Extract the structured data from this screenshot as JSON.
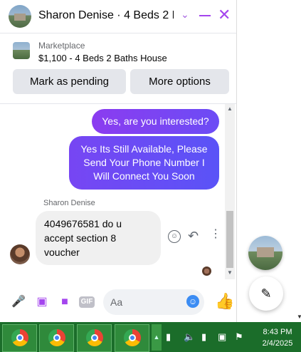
{
  "header": {
    "title": "Sharon Denise · 4 Beds 2 B...",
    "avatar_icon": "house-photo",
    "chevron_icon": "chevron-down-icon",
    "minimize_icon": "minimize-icon",
    "close_icon": "close-icon",
    "accent": "#a445ee"
  },
  "marketplace": {
    "label": "Marketplace",
    "listing": "$1,100 - 4 Beds 2 Baths House",
    "buttons": {
      "pending": "Mark as pending",
      "more": "More options"
    }
  },
  "messages": {
    "outgoing": [
      "Yes, are you interested?",
      "Yes Its Still Available, Please Send Your Phone Number I Will Connect You Soon"
    ],
    "sender_name": "Sharon Denise",
    "incoming": "4049676581 do u accept section 8 voucher"
  },
  "composer": {
    "placeholder": "Aa",
    "gif_label": "GIF"
  },
  "taskbar": {
    "time": "8:43 PM",
    "date": "2/4/2025"
  }
}
